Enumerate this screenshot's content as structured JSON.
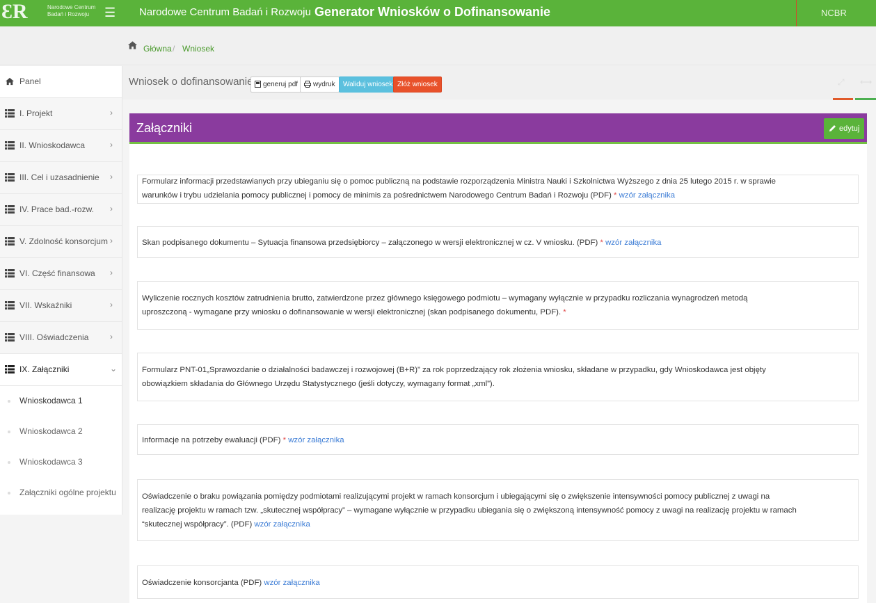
{
  "header": {
    "logo_text_line1": "Narodowe Centrum",
    "logo_text_line2": "Badań i Rozwoju",
    "org_title": "Narodowe Centrum Badań i Rozwoju",
    "app_title": "Generator Wniosków o Dofinansowanie",
    "user_label": "NCBR",
    "menu_icon": "hamburger-icon"
  },
  "breadcrumb": {
    "home": "Główna",
    "separator": "/",
    "current": "Wniosek"
  },
  "sidebar": {
    "items": [
      {
        "label": "Panel",
        "icon": "home-icon"
      },
      {
        "label": "I. Projekt",
        "icon": "list-icon",
        "chevron": "›"
      },
      {
        "label": "II. Wnioskodawca",
        "icon": "list-icon",
        "chevron": "›"
      },
      {
        "label": "III. Cel i uzasadnienie",
        "icon": "list-icon",
        "chevron": "›"
      },
      {
        "label": "IV. Prace bad.-rozw.",
        "icon": "list-icon",
        "chevron": "›"
      },
      {
        "label": "V. Zdolność konsorcjum",
        "icon": "list-icon",
        "chevron": "›"
      },
      {
        "label": "VI. Część finansowa",
        "icon": "list-icon",
        "chevron": "›"
      },
      {
        "label": "VII. Wskaźniki",
        "icon": "list-icon",
        "chevron": "›"
      },
      {
        "label": "VIII. Oświadczenia",
        "icon": "list-icon",
        "chevron": "›"
      },
      {
        "label": "IX. Załączniki",
        "icon": "list-icon",
        "chevron": "⌄"
      }
    ],
    "subitems": [
      {
        "label": "Wnioskodawca 1"
      },
      {
        "label": "Wnioskodawca 2"
      },
      {
        "label": "Wnioskodawca 3"
      },
      {
        "label": "Załączniki ogólne projektu"
      }
    ]
  },
  "toolbar": {
    "title": "Wniosek o dofinansowanie",
    "pdf_label": "generuj pdf",
    "print_label": "wydruk",
    "validate_label": "Waliduj wniosek",
    "submit_label": "Złóż wniosek",
    "expand_glyph": "⤢",
    "collapse_glyph": "⟷"
  },
  "panel": {
    "title": "Załączniki",
    "edit_label": "edytuj"
  },
  "attachments": [
    {
      "lines": [
        "Formularz informacji przedstawianych przy ubieganiu się o pomoc publiczną na podstawie rozporządzenia Ministra Nauki i Szkolnictwa Wyższego z dnia 25 lutego 2015 r. w sprawie",
        "warunków i trybu udzielania pomocy publicznej i pomocy de minimis za pośrednictwem Narodowego Centrum Badań i Rozwoju (PDF)"
      ],
      "required": "*",
      "link": "wzór załącznika"
    },
    {
      "lines": [
        "Skan podpisanego dokumentu – Sytuacja finansowa przedsiębiorcy – załączonego w wersji elektronicznej w cz. V wniosku. (PDF)"
      ],
      "required": "*",
      "link": "wzór załącznika"
    },
    {
      "lines": [
        "Wyliczenie rocznych kosztów zatrudnienia brutto, zatwierdzone przez głównego księgowego podmiotu – wymagany wyłącznie w przypadku rozliczania wynagrodzeń metodą",
        "uproszczoną - wymagane przy wniosku o dofinansowanie w wersji elektronicznej (skan podpisanego dokumentu, PDF)."
      ],
      "required": "*",
      "link": ""
    },
    {
      "lines": [
        "Formularz PNT-01„Sprawozdanie o działalności badawczej i rozwojowej (B+R)” za rok poprzedzający rok złożenia wniosku, składane w przypadku, gdy Wnioskodawca jest objęty",
        "obowiązkiem składania do Głównego Urzędu Statystycznego (jeśli dotyczy, wymagany format „xml”)."
      ],
      "required": "",
      "link": ""
    },
    {
      "lines": [
        "Informacje na potrzeby ewaluacji (PDF)"
      ],
      "required": "*",
      "link": "wzór załącznika"
    },
    {
      "lines": [
        "Oświadczenie o braku powiązania pomiędzy podmiotami realizującymi projekt w ramach konsorcjum i ubiegającymi się o zwiększenie intensywności pomocy publicznej z uwagi na",
        "realizację projektu w ramach tzw. „skutecznej współpracy” – wymagane wyłącznie w przypadku ubiegania się o zwiększoną intensywność pomocy z uwagi na realizację projektu w ramach",
        "“skutecznej współpracy”. (PDF)"
      ],
      "required": "",
      "link": "wzór załącznika"
    },
    {
      "lines": [
        "Oświadczenie konsorcjanta (PDF)"
      ],
      "required": "",
      "link": "wzór załącznika"
    }
  ],
  "colors": {
    "brand_green": "#5ab33a",
    "panel_purple": "#8a3b9e",
    "danger": "#e8512a",
    "info": "#5bc0de",
    "link": "#3a7bd5",
    "required": "#e04848"
  }
}
